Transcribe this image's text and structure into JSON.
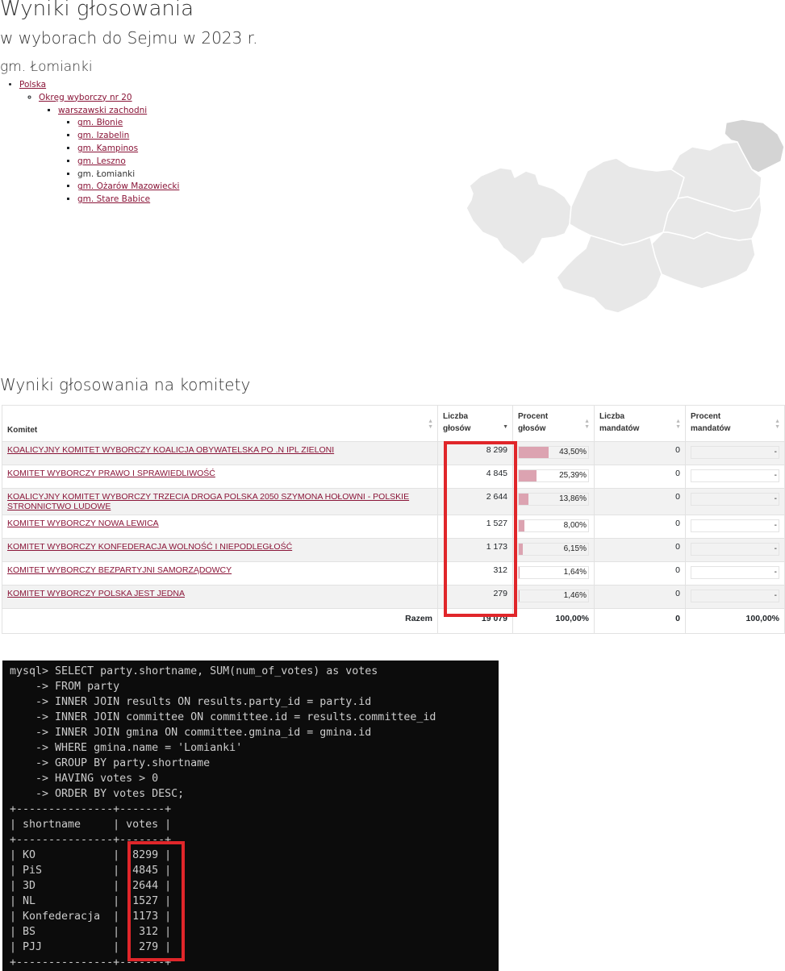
{
  "header": {
    "title": "Wyniki głosowania",
    "subtitle": "w wyborach do Sejmu w 2023 r.",
    "area": "gm. Łomianki"
  },
  "breadcrumb": {
    "country": "Polska",
    "district": "Okręg wyborczy nr 20",
    "county": "warszawski zachodni",
    "gminas": [
      {
        "label": "gm. Błonie",
        "current": false
      },
      {
        "label": "gm. Izabelin",
        "current": false
      },
      {
        "label": "gm. Kampinos",
        "current": false
      },
      {
        "label": "gm. Leszno",
        "current": false
      },
      {
        "label": "gm. Łomianki",
        "current": true
      },
      {
        "label": "gm. Ożarów Mazowiecki",
        "current": false
      },
      {
        "label": "gm. Stare Babice",
        "current": false
      }
    ]
  },
  "map": {
    "region_color": "#e8e8e8",
    "highlight_color": "#d4d4d4",
    "border_color": "#ffffff"
  },
  "results": {
    "section_title": "Wyniki głosowania na komitety",
    "columns": [
      "Komitet",
      "Liczba głosów",
      "Procent głosów",
      "Liczba mandatów",
      "Procent mandatów"
    ],
    "sort_icon": "sort-both-icon",
    "sort_desc_icon": "sort-desc-icon",
    "bar_color": "#dca3b1",
    "rows": [
      {
        "committee": "KOALICYJNY KOMITET WYBORCZY KOALICJA OBYWATELSKA PO .N IPL ZIELONI",
        "votes": "8 299",
        "pct": "43,50%",
        "pct_value": 43.5,
        "seats": "0",
        "seats_pct": "-"
      },
      {
        "committee": "KOMITET WYBORCZY PRAWO I SPRAWIEDLIWOŚĆ",
        "votes": "4 845",
        "pct": "25,39%",
        "pct_value": 25.39,
        "seats": "0",
        "seats_pct": "-"
      },
      {
        "committee": "KOALICYJNY KOMITET WYBORCZY TRZECIA DROGA POLSKA 2050 SZYMONA HOŁOWNI - POLSKIE STRONNICTWO LUDOWE",
        "votes": "2 644",
        "pct": "13,86%",
        "pct_value": 13.86,
        "seats": "0",
        "seats_pct": "-"
      },
      {
        "committee": "KOMITET WYBORCZY NOWA LEWICA",
        "votes": "1 527",
        "pct": "8,00%",
        "pct_value": 8.0,
        "seats": "0",
        "seats_pct": "-"
      },
      {
        "committee": "KOMITET WYBORCZY KONFEDERACJA WOLNOŚĆ I NIEPODLEGŁOŚĆ",
        "votes": "1 173",
        "pct": "6,15%",
        "pct_value": 6.15,
        "seats": "0",
        "seats_pct": "-"
      },
      {
        "committee": "KOMITET WYBORCZY BEZPARTYJNI SAMORZĄDOWCY",
        "votes": "312",
        "pct": "1,64%",
        "pct_value": 1.64,
        "seats": "0",
        "seats_pct": "-"
      },
      {
        "committee": "KOMITET WYBORCZY POLSKA JEST JEDNA",
        "votes": "279",
        "pct": "1,46%",
        "pct_value": 1.46,
        "seats": "0",
        "seats_pct": "-"
      }
    ],
    "total": {
      "label": "Razem",
      "votes": "19 079",
      "pct": "100,00%",
      "seats": "0",
      "seats_pct": "100,00%"
    }
  },
  "highlight_color": "#e0262a",
  "terminal": {
    "background": "#0c0c0c",
    "lines": [
      "mysql> SELECT party.shortname, SUM(num_of_votes) as votes",
      "    -> FROM party",
      "    -> INNER JOIN results ON results.party_id = party.id",
      "    -> INNER JOIN committee ON committee.id = results.committee_id",
      "    -> INNER JOIN gmina ON committee.gmina_id = gmina.id",
      "    -> WHERE gmina.name = 'Lomianki'",
      "    -> GROUP BY party.shortname",
      "    -> HAVING votes > 0",
      "    -> ORDER BY votes DESC;",
      "+---------------+-------+",
      "| shortname     | votes |",
      "+---------------+-------+",
      "| KO            |  8299 |",
      "| PiS           |  4845 |",
      "| 3D            |  2644 |",
      "| NL            |  1527 |",
      "| Konfederacja  |  1173 |",
      "| BS            |   312 |",
      "| PJJ           |   279 |",
      "+---------------+-------+"
    ]
  }
}
